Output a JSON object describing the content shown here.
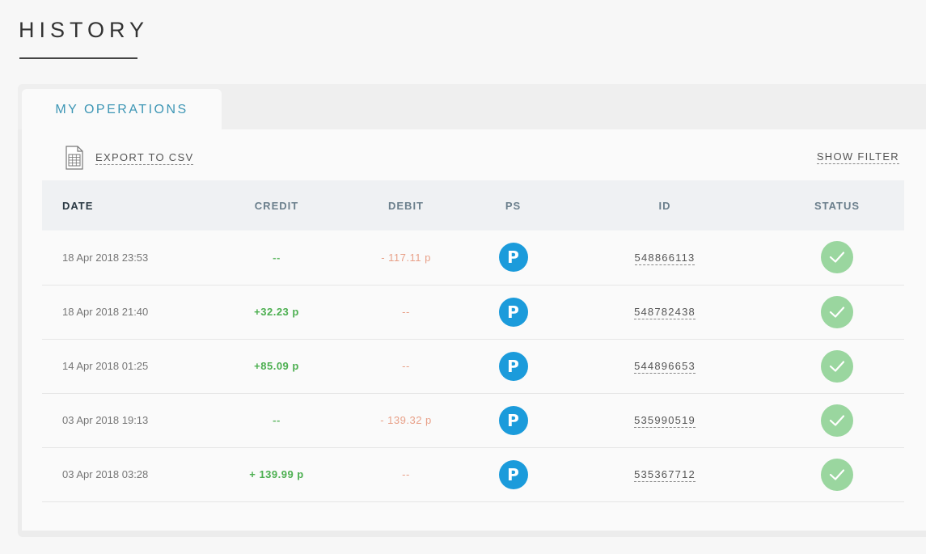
{
  "page": {
    "title": "HISTORY"
  },
  "tabs": [
    {
      "label": "MY OPERATIONS",
      "active": true
    }
  ],
  "toolbar": {
    "export_label": "EXPORT TO CSV",
    "export_icon": "spreadsheet-icon",
    "filter_label": "SHOW FILTER"
  },
  "table": {
    "headers": {
      "date": "DATE",
      "credit": "CREDIT",
      "debit": "DEBIT",
      "ps": "PS",
      "id": "ID",
      "status": "STATUS"
    },
    "rows": [
      {
        "date": "18 Apr 2018 23:53",
        "credit": "--",
        "debit": "- 117.11 p",
        "ps": "P",
        "id": "548866113",
        "status": "completed"
      },
      {
        "date": "18 Apr 2018 21:40",
        "credit": "+32.23 p",
        "debit": "--",
        "ps": "P",
        "id": "548782438",
        "status": "completed"
      },
      {
        "date": "14 Apr 2018 01:25",
        "credit": "+85.09 p",
        "debit": "--",
        "ps": "P",
        "id": "544896653",
        "status": "completed"
      },
      {
        "date": "03 Apr 2018 19:13",
        "credit": "--",
        "debit": "- 139.32 p",
        "ps": "P",
        "id": "535990519",
        "status": "completed"
      },
      {
        "date": "03 Apr 2018 03:28",
        "credit": "+ 139.99 p",
        "debit": "--",
        "ps": "P",
        "id": "535367712",
        "status": "completed"
      }
    ]
  },
  "colors": {
    "accent": "#3d96b5",
    "credit": "#4caf50",
    "debit": "#e8a088",
    "ps_badge": "#1b9bdb",
    "status_ok": "#9ad69f"
  }
}
